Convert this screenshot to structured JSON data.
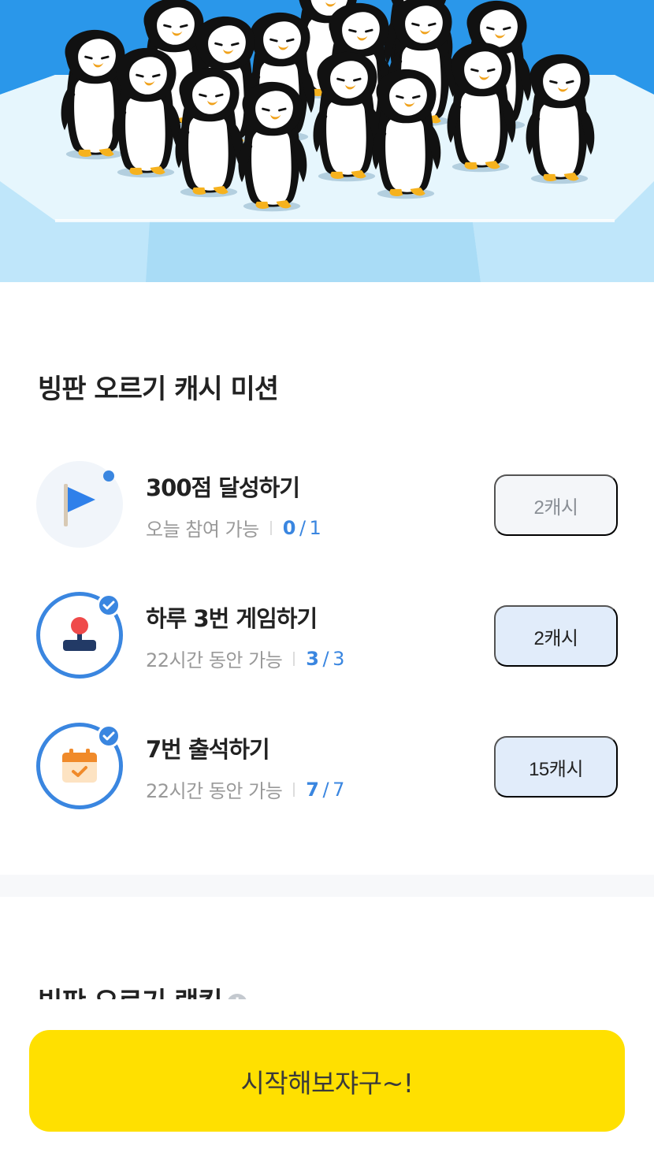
{
  "mission_section": {
    "title": "빙판 오르기 캐시 미션"
  },
  "missions": [
    {
      "name": "300점 달성하기",
      "availability": "오늘 참여 가능",
      "current": "0",
      "total": "1",
      "reward": "2캐시",
      "icon": "flag-icon",
      "completed": false
    },
    {
      "name": "하루 3번 게임하기",
      "availability": "22시간 동안 가능",
      "current": "3",
      "total": "3",
      "reward": "2캐시",
      "icon": "joystick-icon",
      "completed": true
    },
    {
      "name": "7번 출석하기",
      "availability": "22시간 동안 가능",
      "current": "7",
      "total": "7",
      "reward": "15캐시",
      "icon": "calendar-icon",
      "completed": true
    }
  ],
  "ranking_section": {
    "title": "빙판 오르기 랭킹"
  },
  "cta": {
    "label": "시작해보쟈구~!"
  },
  "colors": {
    "accent": "#3a86e0",
    "cta": "#ffe000",
    "sky": "#2a97ea",
    "ice": "#dff2fc"
  }
}
